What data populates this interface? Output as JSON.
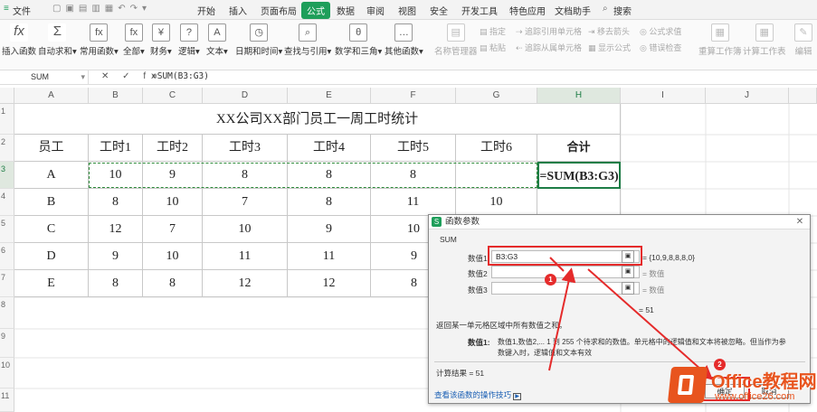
{
  "menu": {
    "file_label": "文件",
    "tabs": [
      "开始",
      "插入",
      "页面布局",
      "公式",
      "数据",
      "审阅",
      "视图",
      "安全",
      "开发工具",
      "特色应用",
      "文档助手"
    ],
    "search_label": "搜索"
  },
  "ribbon": {
    "insert_function": "插入函数",
    "autosum": "自动求和",
    "common": "常用函数",
    "all": "全部",
    "finance": "财务",
    "logic": "逻辑",
    "text": "文本",
    "datetime": "日期和时间",
    "lookup": "查找与引用",
    "math": "数学和三角",
    "other": "其他函数",
    "name_manager": "名称管理器",
    "define": "指定",
    "paste": "粘贴",
    "trace_precedents": "追踪引用单元格",
    "trace_dependents": "追踪从属单元格",
    "remove_arrows": "移去箭头",
    "show_formulas": "显示公式",
    "formula_eval": "公式求值",
    "error_check": "错误检查",
    "recalc_book": "重算工作簿",
    "calc_sheet": "计算工作表",
    "edit": "编辑"
  },
  "formula_bar": {
    "name_box": "SUM",
    "icons": "✕ ✓ fx",
    "formula": "=SUM(B3:G3)"
  },
  "columns": [
    "A",
    "B",
    "C",
    "D",
    "E",
    "F",
    "G",
    "H",
    "I",
    "J"
  ],
  "rows": [
    "1",
    "2",
    "3",
    "4",
    "5",
    "6",
    "7",
    "8",
    "9",
    "10",
    "11"
  ],
  "sheet": {
    "title": "XX公司XX部门员工一周工时统计",
    "headers": [
      "员工",
      "工时1",
      "工时2",
      "工时3",
      "工时4",
      "工时5",
      "工时6",
      "合计"
    ],
    "data": [
      [
        "A",
        "10",
        "9",
        "8",
        "8",
        "8",
        "",
        "=SUM(B3:G3)"
      ],
      [
        "B",
        "8",
        "10",
        "7",
        "8",
        "11",
        "10",
        ""
      ],
      [
        "C",
        "12",
        "7",
        "10",
        "9",
        "10",
        "",
        ""
      ],
      [
        "D",
        "9",
        "10",
        "11",
        "11",
        "9",
        "",
        ""
      ],
      [
        "E",
        "8",
        "8",
        "12",
        "12",
        "8",
        "",
        ""
      ]
    ]
  },
  "dialog": {
    "title": "函数参数",
    "close": "✕",
    "func_name": "SUM",
    "arg1_label": "数值1",
    "arg1_value": "B3:G3",
    "arg1_result": "= {10,9,8,8,8,0}",
    "arg2_label": "数值2",
    "arg2_result": "= 数值",
    "arg3_label": "数值3",
    "arg3_result": "= 数值",
    "total_eq": "= 51",
    "description": "返回某一单元格区域中所有数值之和。",
    "arg_help_name": "数值1:",
    "arg_help_line1": "数值1,数值2,... 1 到 255 个待求和的数值。单元格中的逻辑值和文本将被忽略。但当作为参",
    "arg_help_line2": "数键入时，逻辑值和文本有效",
    "calc_result": "计算结果 = 51",
    "help_link": "查看该函数的操作技巧",
    "ok": "确定",
    "cancel": "取消"
  },
  "annotations": {
    "badge1": "1",
    "badge2": "2"
  },
  "watermark": {
    "brand": "Office教程网",
    "url": "www.office26.com"
  },
  "colors": {
    "accent": "#1e9e5a",
    "annotation": "#e52b2b",
    "marquee": "#2e8b3a"
  }
}
